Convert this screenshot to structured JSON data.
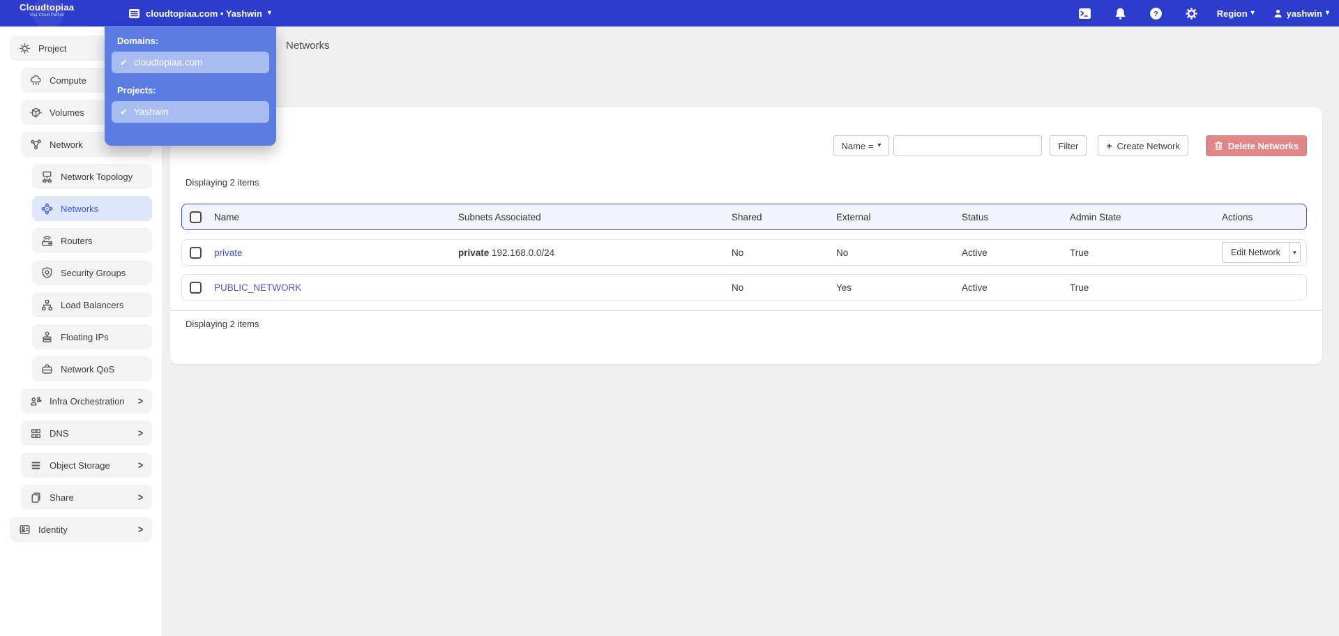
{
  "colors": {
    "navbar": "#2c3ccd",
    "dropdown_panel": "#5b7ce2",
    "dropdown_item": "#a7bcf0",
    "page_bg": "#f0f0f1",
    "active_item_bg": "#dde6fa",
    "active_item_fg": "#3f5bd8",
    "table_header_border": "#3c4fd6",
    "table_header_bg": "#f2f4fc",
    "link": "#4753d9",
    "delete_button": "#e28787"
  },
  "navbar": {
    "brand": {
      "name": "Cloudtopiaa",
      "tagline": "Your Cloud Partner"
    },
    "context_switcher": {
      "label": "cloudtopiaa.com • Yashwin",
      "caret": "▾"
    },
    "right": {
      "region_label": "Region",
      "region_caret": "▾",
      "user_label": "yashwin",
      "user_caret": "▾"
    }
  },
  "context_dropdown": {
    "domains_label": "Domains:",
    "domains": [
      {
        "label": "cloudtopiaa.com",
        "check": "✔",
        "selected": true
      }
    ],
    "projects_label": "Projects:",
    "projects": [
      {
        "label": "Yashwin",
        "check": "✔",
        "selected": true
      }
    ]
  },
  "sidebar": {
    "items": [
      {
        "label": "Project",
        "level": 1,
        "icon": "project-icon"
      },
      {
        "label": "Compute",
        "level": 2,
        "icon": "compute-icon"
      },
      {
        "label": "Volumes",
        "level": 2,
        "icon": "volumes-icon"
      },
      {
        "label": "Network",
        "level": 2,
        "icon": "network-icon"
      },
      {
        "label": "Network Topology",
        "level": 3,
        "icon": "network-topology-icon"
      },
      {
        "label": "Networks",
        "level": 3,
        "icon": "networks-icon",
        "active": true
      },
      {
        "label": "Routers",
        "level": 3,
        "icon": "routers-icon"
      },
      {
        "label": "Security Groups",
        "level": 3,
        "icon": "security-groups-icon"
      },
      {
        "label": "Load Balancers",
        "level": 3,
        "icon": "load-balancers-icon"
      },
      {
        "label": "Floating IPs",
        "level": 3,
        "icon": "floating-ips-icon"
      },
      {
        "label": "Network QoS",
        "level": 3,
        "icon": "network-qos-icon"
      },
      {
        "label": "Infra Orchestration",
        "level": 2,
        "icon": "infra-orchestration-icon",
        "chevron": ">"
      },
      {
        "label": "DNS",
        "level": 2,
        "icon": "dns-icon",
        "chevron": ">"
      },
      {
        "label": "Object Storage",
        "level": 2,
        "icon": "object-storage-icon",
        "chevron": ">"
      },
      {
        "label": "Share",
        "level": 2,
        "icon": "share-icon",
        "chevron": ">"
      },
      {
        "label": "Identity",
        "level": 1,
        "icon": "identity-icon",
        "chevron": ">"
      }
    ]
  },
  "page": {
    "title": "Networks",
    "toolbar": {
      "filter_field_label": "Name =",
      "filter_field_caret": "▾",
      "filter_input_value": "",
      "filter_input_placeholder": "",
      "filter_button_label": "Filter",
      "create_button_icon": "+",
      "create_button_label": "Create Network",
      "delete_button_label": "Delete Networks"
    },
    "table": {
      "count_top": "Displaying 2 items",
      "count_bottom": "Displaying 2 items",
      "columns": [
        "Name",
        "Subnets Associated",
        "Shared",
        "External",
        "Status",
        "Admin State",
        "Actions"
      ],
      "rows": [
        {
          "name": "private",
          "subnet_name": "private",
          "subnet_cidr": "192.168.0.0/24",
          "shared": "No",
          "external": "No",
          "status": "Active",
          "admin_state": "True",
          "action": "Edit Network",
          "action_caret": "▾"
        },
        {
          "name": "PUBLIC_NETWORK",
          "subnet_name": "",
          "subnet_cidr": "",
          "shared": "No",
          "external": "Yes",
          "status": "Active",
          "admin_state": "True",
          "action": "",
          "action_caret": ""
        }
      ]
    }
  }
}
